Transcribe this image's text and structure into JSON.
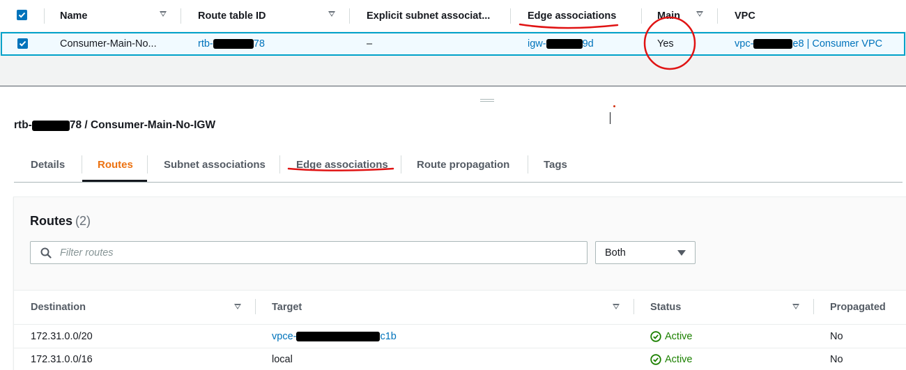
{
  "route_tables": {
    "columns": {
      "name": "Name",
      "route_table_id": "Route table ID",
      "explicit_subnet": "Explicit subnet associat...",
      "edge_associations": "Edge associations",
      "main": "Main",
      "vpc": "VPC"
    },
    "selected_row": {
      "name": "Consumer-Main-No...",
      "route_table_id_prefix": "rtb-",
      "route_table_id_suffix": "78",
      "explicit_subnet": "–",
      "edge_prefix": "igw-",
      "edge_suffix": "9d",
      "main": "Yes",
      "vpc_prefix": "vpc-",
      "vpc_suffix": "e8 | Consumer VPC"
    }
  },
  "detail_panel": {
    "title_prefix": "rtb-",
    "title_suffix": "78 / Consumer-Main-No-IGW",
    "tabs": {
      "details": "Details",
      "routes": "Routes",
      "subnet_associations": "Subnet associations",
      "edge_associations": "Edge associations",
      "route_propagation": "Route propagation",
      "tags": "Tags"
    }
  },
  "routes": {
    "title": "Routes",
    "count": "(2)",
    "filter_placeholder": "Filter routes",
    "select_value": "Both",
    "columns": {
      "destination": "Destination",
      "target": "Target",
      "status": "Status",
      "propagated": "Propagated"
    },
    "rows": [
      {
        "destination": "172.31.0.0/20",
        "target_prefix": "vpce-",
        "target_suffix": "c1b",
        "status": "Active",
        "propagated": "No"
      },
      {
        "destination": "172.31.0.0/16",
        "target": "local",
        "status": "Active",
        "propagated": "No"
      }
    ]
  },
  "colors": {
    "link": "#0073bb",
    "active_tab": "#ec7211",
    "status_ok": "#1d8102",
    "annotation": "#e01313"
  }
}
